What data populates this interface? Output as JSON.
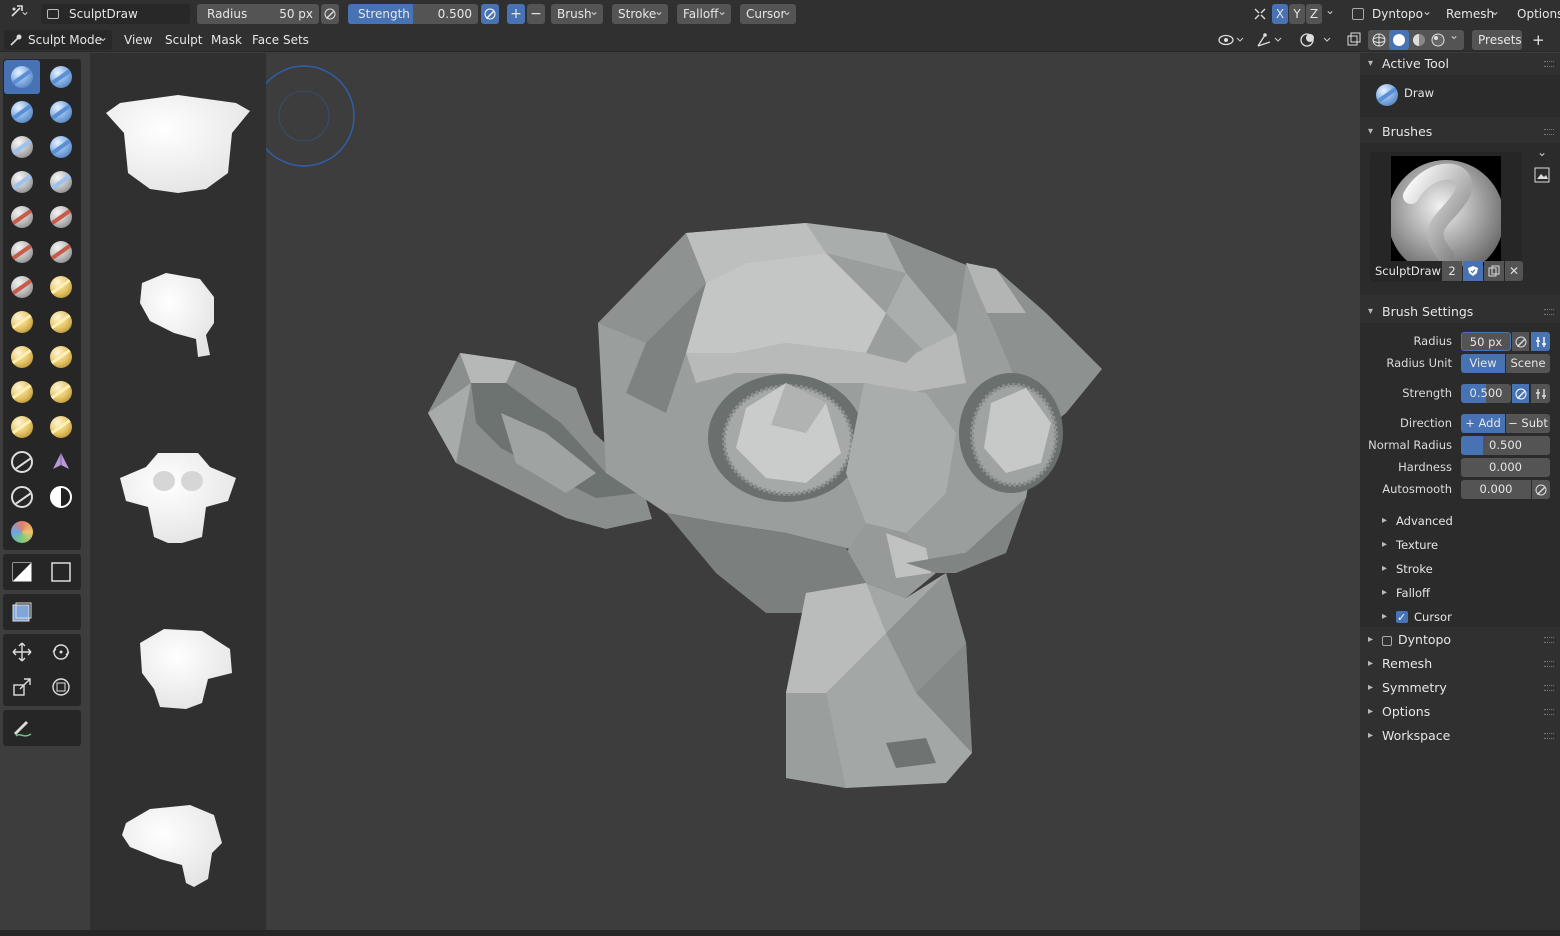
{
  "header": {
    "mode_icon": "sculpt-editor-type-icon",
    "brush_name": "SculptDraw",
    "radius_label": "Radius",
    "radius_value": "50 px",
    "strength_label": "Strength",
    "strength_value": "0.500",
    "strength_fraction": 0.5,
    "plus": "+",
    "minus": "−",
    "menus": [
      "Brush",
      "Stroke",
      "Falloff",
      "Cursor"
    ],
    "axes": [
      "X",
      "Y",
      "Z"
    ],
    "dyntopo": "Dyntopo",
    "remesh": "Remesh",
    "options": "Options"
  },
  "subheader": {
    "mode": "Sculpt Mode",
    "menus": [
      "View",
      "Sculpt",
      "Mask",
      "Face Sets"
    ],
    "presets": "Presets",
    "add": "+"
  },
  "panel": {
    "active_tool_title": "Active Tool",
    "active_tool_name": "Draw",
    "brushes_title": "Brushes",
    "brush_name": "SculptDraw",
    "brush_users": "2",
    "brush_settings_title": "Brush Settings",
    "radius_label": "Radius",
    "radius_value": "50 px",
    "radius_unit_label": "Radius Unit",
    "radius_unit_view": "View",
    "radius_unit_scene": "Scene",
    "strength_label": "Strength",
    "strength_value": "0.500",
    "direction_label": "Direction",
    "direction_add": "+ Add",
    "direction_subt": "− Subt",
    "normal_radius_label": "Normal Radius",
    "normal_radius_value": "0.500",
    "hardness_label": "Hardness",
    "hardness_value": "0.000",
    "autosmooth_label": "Autosmooth",
    "autosmooth_value": "0.000",
    "subpanels": [
      "Advanced",
      "Texture",
      "Stroke",
      "Falloff",
      "Cursor"
    ],
    "sections": [
      "Dyntopo",
      "Remesh",
      "Symmetry",
      "Options",
      "Workspace"
    ]
  },
  "colors": {
    "accent": "#4772b3",
    "header_bg": "#303030",
    "viewport_bg": "#3d3d3d",
    "widget_bg": "#545454"
  }
}
